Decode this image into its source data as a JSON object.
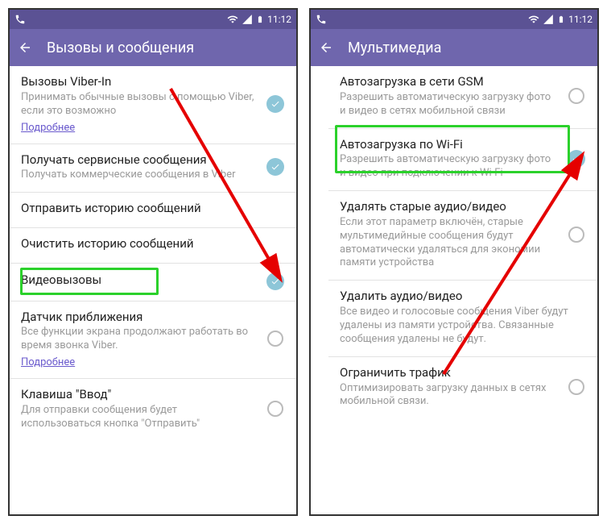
{
  "status": {
    "time": "11:12"
  },
  "left": {
    "title": "Вызовы и сообщения",
    "items": [
      {
        "title": "Вызовы Viber-In",
        "sub": "Принимать обычные вызовы с помощью Viber, если это возможно",
        "link": "Подробнее",
        "checked": true
      },
      {
        "title": "Получать сервисные сообщения",
        "sub": "Получать коммерческие сообщения в Viber",
        "checked": true
      },
      {
        "title": "Отправить историю сообщений"
      },
      {
        "title": "Очистить историю сообщений"
      },
      {
        "title": "Видеовызовы",
        "checked": true,
        "highlight": true
      },
      {
        "title": "Датчик приближения",
        "sub": "Все функции экрана продолжают работать во время звонка Viber.",
        "link": "Подробнее",
        "checked": false
      },
      {
        "title": "Клавиша \"Ввод\"",
        "sub": "Для отправки сообщения будет использоваться кнопка \"Отправить\"",
        "checked": false
      }
    ]
  },
  "right": {
    "title": "Мультимедиа",
    "items": [
      {
        "title": "Автозагрузка в сети GSM",
        "sub": "Разрешить автоматическую загрузку фото и видео в сетях мобильной связи",
        "checked": false
      },
      {
        "title": "Автозагрузка по Wi-Fi",
        "sub": "Разрешить автоматическую загрузку фото и видео при подключении к Wi-Fi",
        "checked": true,
        "highlight": true
      },
      {
        "title": "Удалять старые аудио/видео",
        "sub": "Если этот параметр включён, старые мультимедийные сообщения будут автоматически удаляться для экономии памяти устройства",
        "checked": false
      },
      {
        "title": "Удалить аудио/видео",
        "sub": "Все видео и голосовые сообщения Viber будут удалены из памяти устройства. Связанные сообщения удалены не будут."
      },
      {
        "title": "Ограничить трафик",
        "sub": "Оптимизировать загрузку данных в сетях мобильной связи.",
        "checked": false
      }
    ]
  }
}
